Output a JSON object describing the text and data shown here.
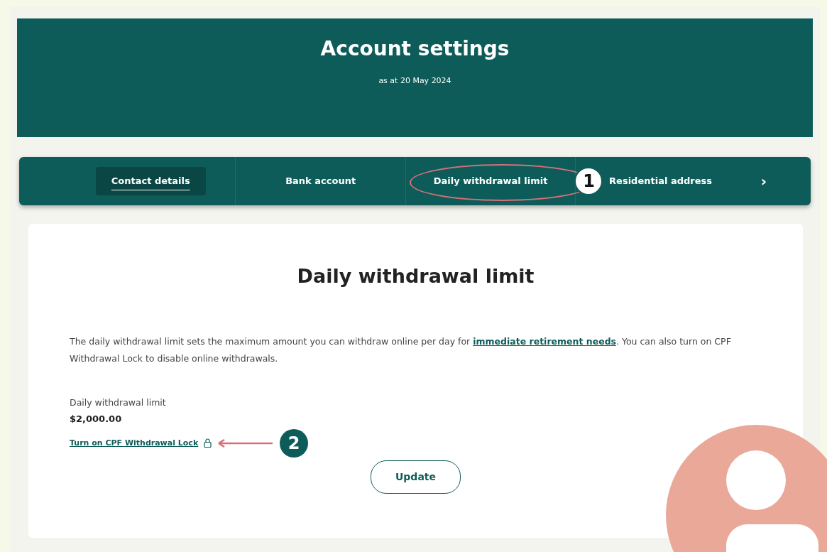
{
  "header": {
    "title": "Account settings",
    "subtitle": "as at 20 May 2024"
  },
  "tabs": [
    {
      "label": "Contact details",
      "selected": true
    },
    {
      "label": "Bank account",
      "selected": false
    },
    {
      "label": "Daily withdrawal limit",
      "selected": false,
      "annotation": "1"
    },
    {
      "label": "Residential address",
      "selected": false
    }
  ],
  "tabs_next": "›",
  "section": {
    "title": "Daily withdrawal limit",
    "intro": [
      "The daily withdrawal limit sets the maximum amount you can withdraw online per day for ",
      "immediate retirement needs",
      ". You can also turn on CPF Withdrawal Lock to disable online withdrawals."
    ],
    "limit_label": "Daily withdrawal limit",
    "limit_value": "$2,000.00",
    "lock_link": "Turn on CPF Withdrawal Lock",
    "lock_annotation": "2",
    "button": "Update"
  }
}
